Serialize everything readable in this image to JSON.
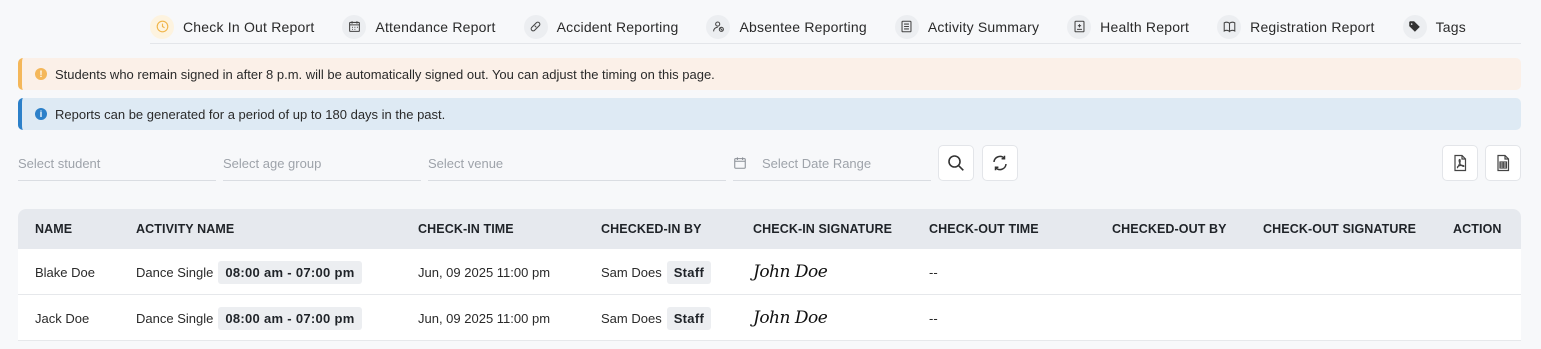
{
  "tabs": [
    {
      "label": "Check In Out Report",
      "icon": "clock-icon"
    },
    {
      "label": "Attendance Report",
      "icon": "calendar-icon"
    },
    {
      "label": "Accident Reporting",
      "icon": "bandage-icon"
    },
    {
      "label": "Absentee Reporting",
      "icon": "user-x-icon"
    },
    {
      "label": "Activity Summary",
      "icon": "list-icon"
    },
    {
      "label": "Health Report",
      "icon": "medical-icon"
    },
    {
      "label": "Registration Report",
      "icon": "book-icon"
    },
    {
      "label": "Tags",
      "icon": "tag-icon"
    }
  ],
  "alerts": {
    "warning": "Students who remain signed in after 8 p.m. will be automatically signed out. You can adjust the timing on this page.",
    "info": "Reports can be generated for a period of up to 180 days in the past."
  },
  "filters": {
    "student_placeholder": "Select student",
    "age_group_placeholder": "Select age group",
    "venue_placeholder": "Select venue",
    "date_range_placeholder": "Select Date Range"
  },
  "table": {
    "headers": [
      "NAME",
      "ACTIVITY NAME",
      "CHECK-IN TIME",
      "CHECKED-IN BY",
      "CHECK-IN SIGNATURE",
      "CHECK-OUT TIME",
      "CHECKED-OUT BY",
      "CHECK-OUT SIGNATURE",
      "ACTION"
    ],
    "rows": [
      {
        "name": "Blake Doe",
        "activity": "Dance Single",
        "time_slot": "08:00 am - 07:00 pm",
        "checkin_time": "Jun, 09 2025 11:00 pm",
        "checked_in_by": "Sam Does",
        "role": "Staff",
        "checkin_signature": "John Doe",
        "checkout_time": "--"
      },
      {
        "name": "Jack Doe",
        "activity": "Dance Single",
        "time_slot": "08:00 am - 07:00 pm",
        "checkin_time": "Jun, 09 2025 11:00 pm",
        "checked_in_by": "Sam Does",
        "role": "Staff",
        "checkin_signature": "John Doe",
        "checkout_time": "--"
      }
    ]
  },
  "colors": {
    "warning_accent": "#f4b75a",
    "info_accent": "#2c80c9",
    "header_bg": "#e6e9ee"
  }
}
